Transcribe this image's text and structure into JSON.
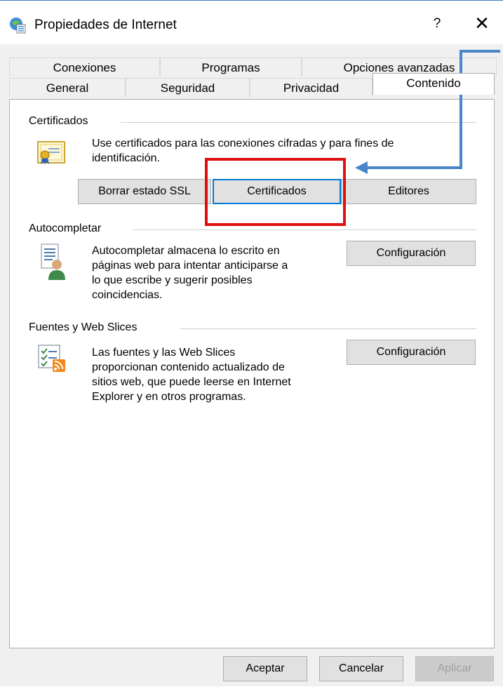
{
  "window": {
    "title": "Propiedades de Internet",
    "help_label": "?",
    "close_label": "✕"
  },
  "tabs": {
    "row1": [
      "Conexiones",
      "Programas",
      "Opciones avanzadas"
    ],
    "row2": [
      "General",
      "Seguridad",
      "Privacidad",
      "Contenido"
    ],
    "active": "Contenido"
  },
  "certificates": {
    "label": "Certificados",
    "description_line1": "Use certificados para las conexiones cifradas y para fines de",
    "description_line2": "identificación.",
    "buttons": [
      "Borrar estado SSL",
      "Certificados",
      "Editores"
    ]
  },
  "autocomplete": {
    "label": "Autocompletar",
    "description": [
      "Autocompletar almacena lo escrito en",
      "páginas web para intentar anticiparse a",
      "lo que escribe y sugerir posibles",
      "coincidencias."
    ],
    "button": "Configuración"
  },
  "feeds": {
    "label": "Fuentes y Web Slices",
    "description": [
      "Las fuentes y las Web Slices",
      "proporcionan contenido actualizado de",
      "sitios web, que puede leerse en Internet",
      "Explorer y en otros programas."
    ],
    "button": "Configuración"
  },
  "footer": {
    "ok": "Aceptar",
    "cancel": "Cancelar",
    "apply": "Aplicar"
  },
  "annotations": {
    "highlight_color": "#e01010",
    "arrow_color": "#4a86c8"
  }
}
